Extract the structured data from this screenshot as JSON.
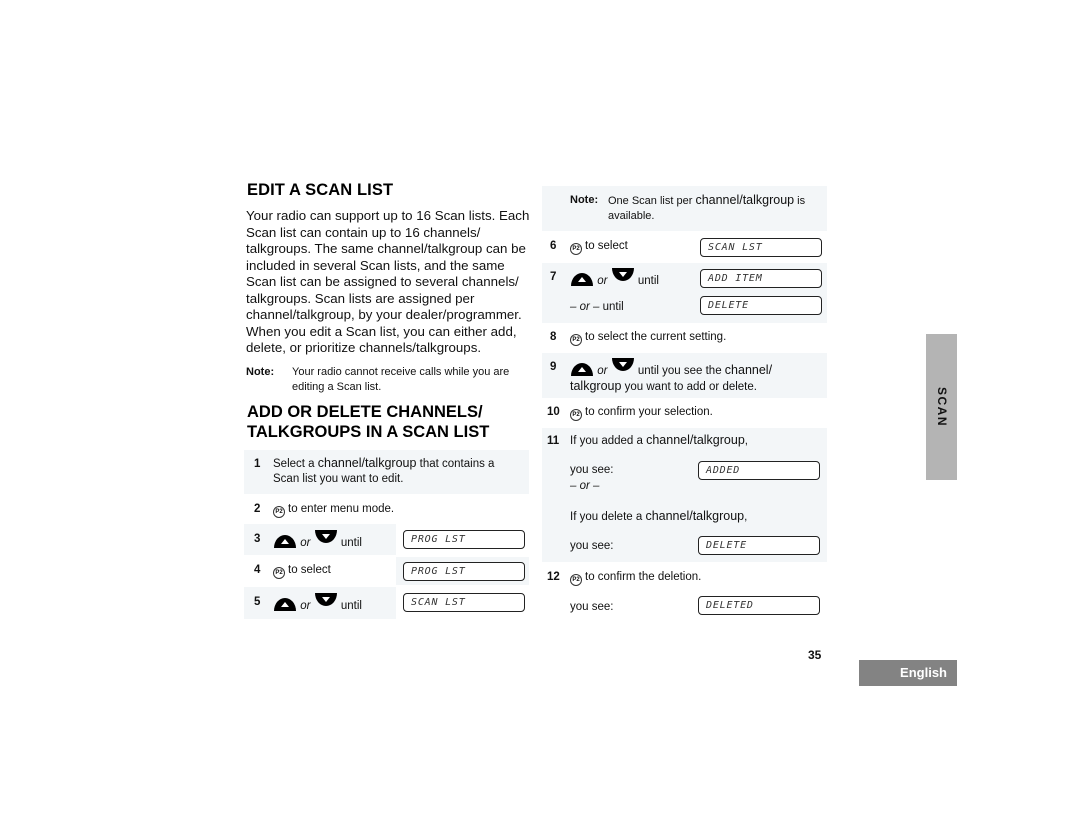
{
  "section1": {
    "title": "EDIT A SCAN LIST",
    "intro": "Your radio can support up to 16 Scan lists. Each Scan list can contain up to 16 channels/ talkgroups. The same channel/talkgroup can be included in several Scan lists, and the same Scan list can be assigned to several channels/ talkgroups. Scan lists are assigned per channel/talkgroup, by your dealer/programmer. When you edit a Scan list, you can either add, delete, or prioritize channels/talkgroups.",
    "note_label": "Note:",
    "note_text": "Your radio cannot receive calls while you are editing a Scan list."
  },
  "section2": {
    "title_line1": "ADD OR DELETE CHANNELS/",
    "title_line2": "TALKGROUPS IN A SCAN LIST"
  },
  "icons": {
    "p2": "P2",
    "or": "or",
    "until": "until"
  },
  "steps": {
    "s1": {
      "num": "1",
      "text_a": "Select a ",
      "text_b": "channel/talkgroup",
      "text_c": " that contains a Scan list you want to edit."
    },
    "s2": {
      "num": "2",
      "text": "to enter menu mode."
    },
    "s3": {
      "num": "3",
      "display": "PROG LST"
    },
    "s4": {
      "num": "4",
      "text": "to select",
      "display": "PROG LST"
    },
    "s5": {
      "num": "5",
      "display": "SCAN LST"
    },
    "note": {
      "label": "Note:",
      "text_a": "One Scan list per ",
      "text_b": "channel/talkgroup",
      "text_c": " is available."
    },
    "s6": {
      "num": "6",
      "text": "to select",
      "display": "SCAN LST"
    },
    "s7": {
      "num": "7",
      "display": "ADD ITEM",
      "alt_text": "until",
      "alt_or": "– or –",
      "alt_display": "DELETE"
    },
    "s8": {
      "num": "8",
      "text": "to select the current setting."
    },
    "s9": {
      "num": "9",
      "text_a": "until you see the ",
      "text_b": "channel/",
      "text_c": "talkgroup",
      "text_d": " you want to add or delete."
    },
    "s10": {
      "num": "10",
      "text": "to confirm your selection."
    },
    "s11": {
      "num": "11",
      "text_a": "If you added a ",
      "text_b": "channel/talkgroup",
      "text_c": ",",
      "you_see_1": "you see:",
      "display_1": "ADDED",
      "or": "– or –",
      "text_d": "If you delete a ",
      "text_e": "channel/talkgroup",
      "text_f": ",",
      "you_see_2": "you see:",
      "display_2": "DELETE"
    },
    "s12": {
      "num": "12",
      "text": "to confirm the deletion.",
      "you_see": "you see:",
      "display": "DELETED"
    }
  },
  "footer": {
    "page_number": "35",
    "language_tab": "English",
    "section_tab": "SCAN"
  }
}
